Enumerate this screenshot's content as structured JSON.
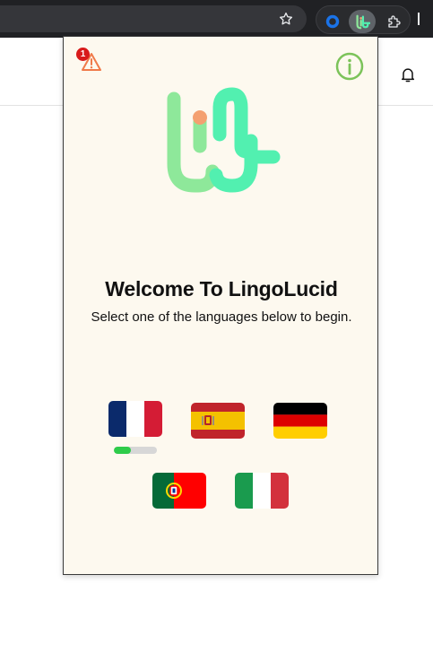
{
  "browser": {
    "star_icon": "star-outline-icon",
    "extensions": [
      {
        "name": "blue-ring-extension",
        "icon": "blue-ring-icon"
      },
      {
        "name": "lingolucid-extension",
        "icon": "lingolucid-icon",
        "active": true
      },
      {
        "name": "puzzle-extension",
        "icon": "puzzle-icon"
      }
    ]
  },
  "page": {
    "bell_icon": "bell-icon"
  },
  "popup": {
    "warning_badge_count": "1",
    "warning_icon": "warning-triangle-icon",
    "info_icon": "info-circle-icon",
    "title": "Welcome To LingoLucid",
    "subtitle": "Select one of the languages below to begin.",
    "languages": [
      {
        "flag": "france",
        "progress": 0.4
      },
      {
        "flag": "spain"
      },
      {
        "flag": "germany"
      },
      {
        "flag": "portugal"
      },
      {
        "flag": "italy"
      }
    ],
    "colors": {
      "background": "#fdf9ef",
      "logo_green_light": "#8ee89a",
      "logo_green_mint": "#52f0b0",
      "logo_dot": "#f4a070",
      "info_green": "#7cc35a",
      "warning_orange": "#f07a4a",
      "badge_red": "#d81b1b",
      "progress_green": "#2ecc4a"
    }
  }
}
